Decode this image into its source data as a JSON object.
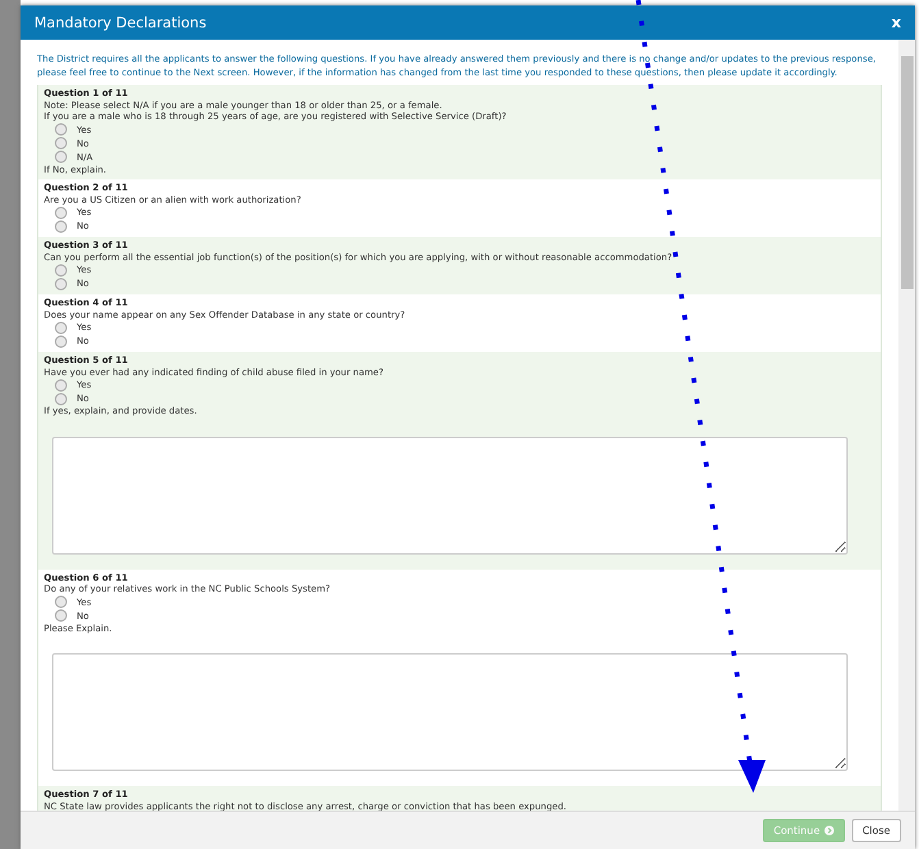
{
  "dialog": {
    "title": "Mandatory Declarations",
    "close": "x"
  },
  "intro": "The District requires all the applicants to answer the following questions. If you have already answered them previously and there is no change and/or updates to the previous response, please feel free to continue to the Next screen. However, if the information has changed from the last time you responded to these questions, then please update it accordingly.",
  "questions": [
    {
      "label": "Question 1 of 11",
      "lines": [
        "Note: Please select N/A if you are a male younger than 18 or older than 25, or a female.",
        "If you are a male who is 18 through 25 years of age, are you registered with Selective Service (Draft)?"
      ],
      "options": [
        {
          "label": "Yes",
          "selected": false
        },
        {
          "label": "No",
          "selected": false
        },
        {
          "label": "N/A",
          "selected": false
        }
      ],
      "follow_up": "If No, explain.",
      "answer_box": false
    },
    {
      "label": "Question 2 of 11",
      "lines": [
        "Are you a US Citizen or an alien with work authorization?"
      ],
      "options": [
        {
          "label": "Yes",
          "selected": false
        },
        {
          "label": "No",
          "selected": false
        }
      ],
      "answer_box": false
    },
    {
      "label": "Question 3 of 11",
      "lines": [
        "Can you perform all the essential job function(s) of the position(s) for which you are applying, with or without reasonable accommodation?"
      ],
      "options": [
        {
          "label": "Yes",
          "selected": false
        },
        {
          "label": "No",
          "selected": false
        }
      ],
      "answer_box": false
    },
    {
      "label": "Question 4 of 11",
      "lines": [
        "Does your name appear on any Sex Offender Database in any state or country?"
      ],
      "options": [
        {
          "label": "Yes",
          "selected": false
        },
        {
          "label": "No",
          "selected": false
        }
      ],
      "answer_box": false
    },
    {
      "label": "Question 5 of 11",
      "lines": [
        "Have you ever had any indicated finding of child abuse filed in your name?"
      ],
      "options": [
        {
          "label": "Yes",
          "selected": false
        },
        {
          "label": "No",
          "selected": false
        }
      ],
      "follow_up": "If yes, explain, and provide dates.",
      "answer_box": true
    },
    {
      "label": "Question 6 of 11",
      "lines": [
        "Do any of your relatives work in the NC Public Schools System?"
      ],
      "options": [
        {
          "label": "Yes",
          "selected": false
        },
        {
          "label": "No",
          "selected": false
        }
      ],
      "follow_up": "Please Explain.",
      "answer_box": true
    },
    {
      "label": "Question 7 of 11",
      "lines": [
        "NC State law provides applicants the right not to disclose any arrest, charge or conviction that has been expunged."
      ],
      "answer_box": false
    }
  ],
  "buttons": [
    {
      "label": "Continue",
      "kind": "primary",
      "disabled": true
    },
    {
      "label": "Close",
      "kind": "secondary",
      "disabled": false
    }
  ]
}
